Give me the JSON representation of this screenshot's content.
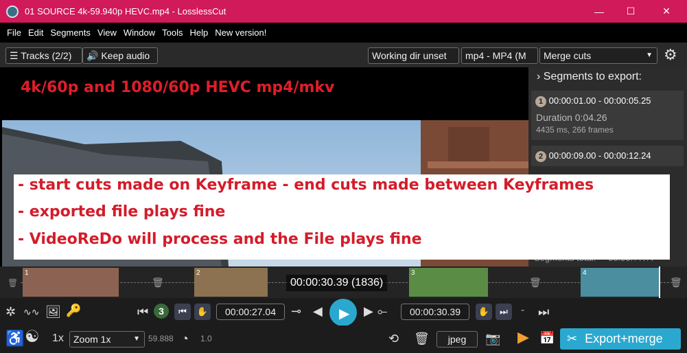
{
  "window": {
    "title": "01 SOURCE 4k-59.940p HEVC.mp4 - LosslessCut",
    "minimize": "—",
    "maximize": "☐",
    "close": "✕"
  },
  "menu": [
    "File",
    "Edit",
    "Segments",
    "View",
    "Window",
    "Tools",
    "Help",
    "New version!"
  ],
  "toolbar": {
    "tracks": "Tracks (2/2)",
    "keep_audio": "Keep audio",
    "working_dir": "Working dir unset",
    "format": "mp4 - MP4 (M",
    "merge_mode": "Merge cuts"
  },
  "annotations": {
    "title": "4k/60p and 1080/60p HEVC mp4/mkv",
    "lines": [
      "- start cuts made on Keyframe - end cuts made between Keyframes",
      "- exported file plays fine",
      "- VideoReDo will process and the File plays fine"
    ]
  },
  "segments_panel": {
    "header": "Segments to export:",
    "items": [
      {
        "num": "1",
        "range": "00:00:01.00 - 00:00:05.25",
        "duration": "Duration 0:04.26",
        "details": "4435 ms, 266 frames"
      },
      {
        "num": "2",
        "range": "00:00:09.00 - 00:00:12.24"
      }
    ],
    "total_label": "Segments total:",
    "total_value": "00:00:??.?7"
  },
  "timeline": {
    "current_time": "00:00:30.39 (1836)",
    "segments": [
      {
        "num": "1",
        "color": "#8c6352"
      },
      {
        "num": "2",
        "color": "#8c7250"
      },
      {
        "num": "3",
        "color": "#5a8c46"
      },
      {
        "num": "4",
        "color": "#4a8ea0"
      }
    ]
  },
  "controls": {
    "segment_number": "3",
    "start_time": "00:00:27.04",
    "end_time": "00:00:30.39",
    "dash": "-"
  },
  "bottom": {
    "speed": "1x",
    "zoom": "Zoom 1x",
    "fps": "59.888",
    "playback_rate": "1.0",
    "capture_format": "jpeg",
    "export_button": "Export+merge"
  },
  "colors": {
    "titlebar": "#d01a5a",
    "accent": "#2aa8cf",
    "annotation_red": "#d41c2a"
  }
}
